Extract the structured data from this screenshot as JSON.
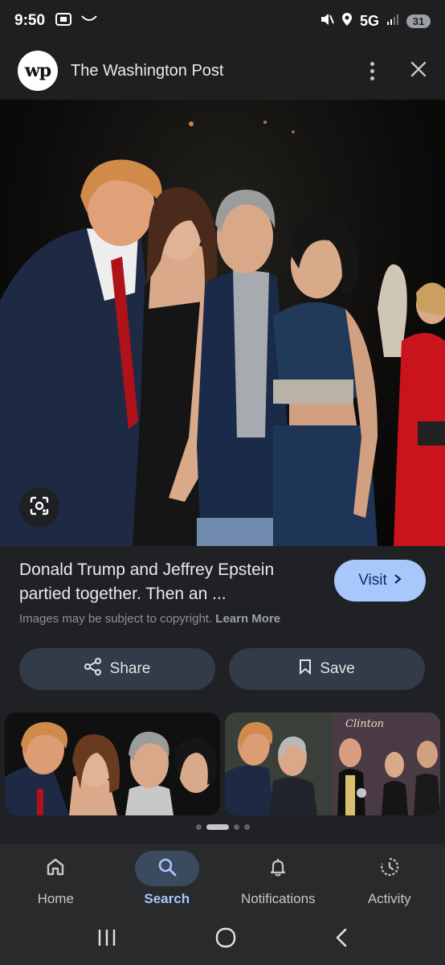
{
  "status_bar": {
    "time": "9:50",
    "network": "5G",
    "battery": "31"
  },
  "header": {
    "logo_text": "wp",
    "source": "The Washington Post"
  },
  "result": {
    "title": "Donald Trump and Jeffrey Epstein partied together. Then an ...",
    "visit_label": "Visit",
    "copyright_text": "Images may be subject to copyright.",
    "learn_more_label": "Learn More",
    "share_label": "Share",
    "save_label": "Save"
  },
  "related": {
    "thumb2_inset_text": "Clinton",
    "carousel_active_index": 1,
    "carousel_count": 4
  },
  "bottom_nav": {
    "items": [
      {
        "label": "Home",
        "icon": "home-icon"
      },
      {
        "label": "Search",
        "icon": "search-icon"
      },
      {
        "label": "Notifications",
        "icon": "bell-icon"
      },
      {
        "label": "Activity",
        "icon": "history-icon"
      }
    ],
    "active": "Search"
  },
  "colors": {
    "accent": "#a8c7fa",
    "background": "#202124",
    "pill": "#333b48"
  }
}
